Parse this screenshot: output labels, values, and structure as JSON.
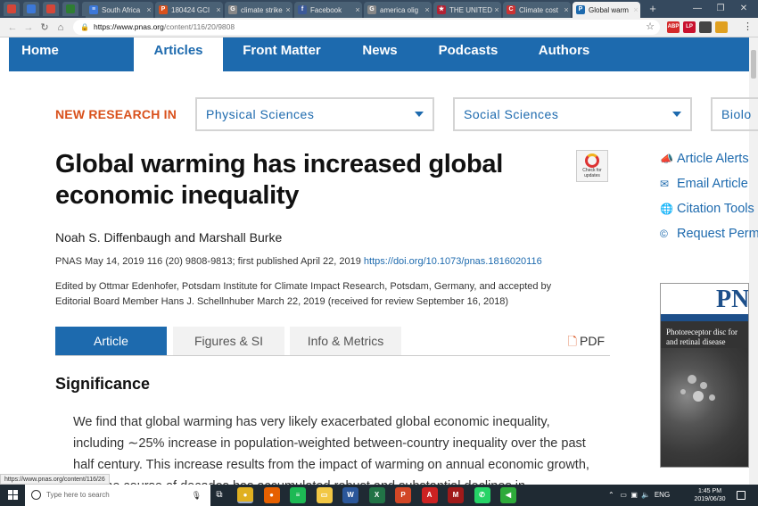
{
  "browser": {
    "tabs": [
      {
        "label": "South Africa",
        "color": "#3c78d8",
        "glyph": "≡",
        "active": false
      },
      {
        "label": "180424 GCI",
        "color": "#d9511c",
        "glyph": "P",
        "active": false
      },
      {
        "label": "climate strike",
        "color": "#888888",
        "glyph": "G",
        "active": false
      },
      {
        "label": "Facebook",
        "color": "#3b5998",
        "glyph": "f",
        "active": false
      },
      {
        "label": "america olig",
        "color": "#888888",
        "glyph": "G",
        "active": false
      },
      {
        "label": "THE UNITED",
        "color": "#b22234",
        "glyph": "★",
        "active": false
      },
      {
        "label": "Climate cost",
        "color": "#cc3333",
        "glyph": "C",
        "active": false
      },
      {
        "label": "Global warm",
        "color": "#1d6aae",
        "glyph": "P",
        "active": true
      }
    ],
    "pinned_colors": [
      "#d44638",
      "#3c78d8",
      "#d44638",
      "#2e7d32",
      "#d44638"
    ],
    "url_host": "https://www.pnas.org",
    "url_path": "/content/116/20/9808",
    "status_url": "https://www.pnas.org/content/116/26",
    "extensions": [
      {
        "label": "ABP",
        "color": "#d42a2a"
      },
      {
        "label": "LP",
        "color": "#c8102e"
      },
      {
        "label": "",
        "color": "#444444"
      },
      {
        "label": "",
        "color": "#e0a020"
      }
    ]
  },
  "nav": {
    "items": [
      "Home",
      "Articles",
      "Front Matter",
      "News",
      "Podcasts",
      "Authors"
    ],
    "active": "Articles"
  },
  "filters": {
    "label": "NEW RESEARCH IN",
    "options": [
      "Physical Sciences",
      "Social Sciences",
      "Biolo"
    ]
  },
  "article": {
    "title_line1": "Global warming has increased global",
    "title_line2": "economic inequality",
    "check_updates": "Check for updates",
    "authors": "Noah S. Diffenbaugh and Marshall Burke",
    "citation": "PNAS May 14, 2019 116 (20) 9808-9813; first published April 22, 2019",
    "doi": "https://doi.org/10.1073/pnas.1816020116",
    "edited_line1": "Edited by Ottmar Edenhofer, Potsdam Institute for Climate Impact Research, Potsdam, Germany, and accepted by",
    "edited_line2": "Editorial Board Member Hans J. Schellnhuber March 22, 2019 (received for review September 16, 2018)",
    "tabs": [
      "Article",
      "Figures & SI",
      "Info & Metrics"
    ],
    "pdf_label": "PDF",
    "section_heading": "Significance",
    "body_line1": "We find that global warming has very likely exacerbated global economic inequality,",
    "body_line2": "including ∼25% increase in population-weighted between-country inequality over the past",
    "body_line3": "half century. This increase results from the impact of warming on annual economic growth,",
    "body_line4": "over the course of decades has accumulated robust and substantial declines in"
  },
  "sidebar": {
    "actions": [
      {
        "icon": "megaphone-icon",
        "label": "Article Alerts"
      },
      {
        "icon": "envelope-icon",
        "label": "Email Article"
      },
      {
        "icon": "globe-icon",
        "label": "Citation Tools"
      },
      {
        "icon": "copyright-icon",
        "label": "Request Perm"
      }
    ],
    "cover_title": "Photoreceptor disc for and retinal disease",
    "cover_logo": "PN"
  },
  "taskbar": {
    "search_placeholder": "Type here to search",
    "language": "ENG",
    "time": "1:45 PM",
    "date": "2019/06/30",
    "apps": [
      {
        "name": "chrome",
        "color": "#e0b020",
        "glyph": "●"
      },
      {
        "name": "firefox",
        "color": "#e66000",
        "glyph": "●"
      },
      {
        "name": "spotify",
        "color": "#1db954",
        "glyph": "≡"
      },
      {
        "name": "file-explorer",
        "color": "#f2c744",
        "glyph": "▭"
      },
      {
        "name": "word",
        "color": "#2b579a",
        "glyph": "W"
      },
      {
        "name": "excel",
        "color": "#217346",
        "glyph": "X"
      },
      {
        "name": "powerpoint",
        "color": "#d24726",
        "glyph": "P"
      },
      {
        "name": "acrobat",
        "color": "#cc2222",
        "glyph": "A"
      },
      {
        "name": "mendeley",
        "color": "#a01a1a",
        "glyph": "M"
      },
      {
        "name": "whatsapp",
        "color": "#25d366",
        "glyph": "✆"
      },
      {
        "name": "greenshot",
        "color": "#2eaa3a",
        "glyph": "◀"
      }
    ]
  }
}
